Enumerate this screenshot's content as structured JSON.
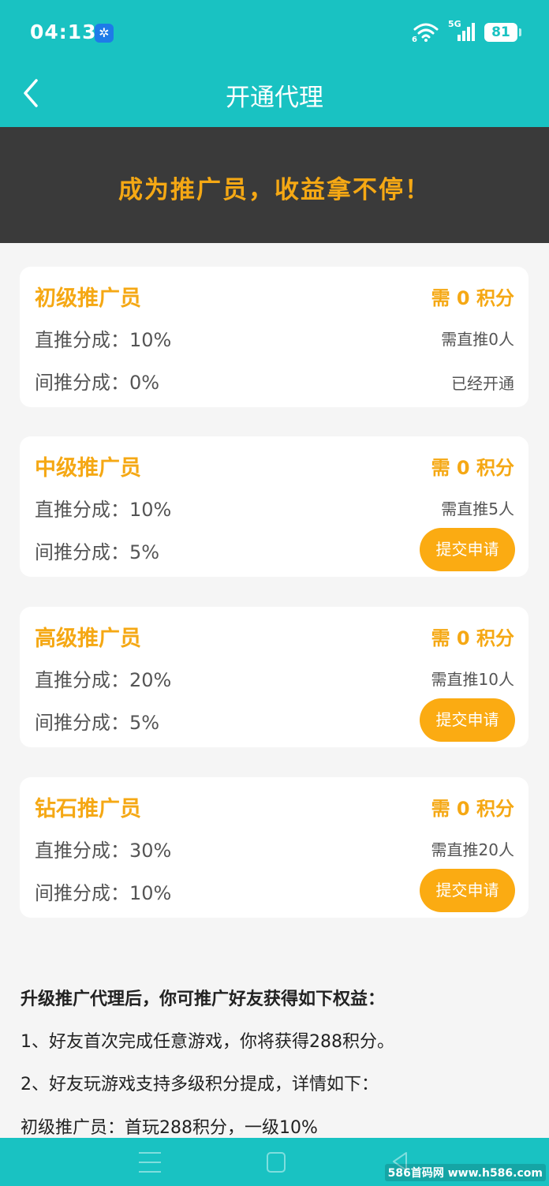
{
  "status_bar": {
    "time": "04:13",
    "network_label": "5G",
    "wifi_sub": "6",
    "battery": "81"
  },
  "header": {
    "title": "开通代理"
  },
  "banner": {
    "text": "成为推广员，收益拿不停！"
  },
  "colors": {
    "primary": "#19c2c2",
    "accent": "#f5a814",
    "banner_bg": "#3a3a3a",
    "button": "#fbab12"
  },
  "tiers": [
    {
      "name": "初级推广员",
      "cost": "需 0 积分",
      "direct": "直推分成：10%",
      "indirect": "间推分成：0%",
      "requirement": "需直推0人",
      "status": "已经开通"
    },
    {
      "name": "中级推广员",
      "cost": "需 0 积分",
      "direct": "直推分成：10%",
      "indirect": "间推分成：5%",
      "requirement": "需直推5人",
      "button": "提交申请"
    },
    {
      "name": "高级推广员",
      "cost": "需 0 积分",
      "direct": "直推分成：20%",
      "indirect": "间推分成：5%",
      "requirement": "需直推10人",
      "button": "提交申请"
    },
    {
      "name": "钻石推广员",
      "cost": "需 0 积分",
      "direct": "直推分成：30%",
      "indirect": "间推分成：10%",
      "requirement": "需直推20人",
      "button": "提交申请"
    }
  ],
  "info": {
    "heading": "升级推广代理后，你可推广好友获得如下权益：",
    "lines": [
      "1、好友首次完成任意游戏，你将获得288积分。",
      "2、好友玩游戏支持多级积分提成，详情如下：",
      "初级推广员：首玩288积分，一级10%"
    ]
  },
  "watermark": "586首码网 www.h586.com",
  "icons": {
    "back": "chevron-left-icon",
    "app": "pinwheel-app-icon",
    "wifi": "wifi-icon",
    "signal": "signal-icon",
    "battery": "battery-icon",
    "nav_menu": "menu-icon",
    "nav_home": "home-square-icon",
    "nav_back": "back-triangle-icon"
  }
}
